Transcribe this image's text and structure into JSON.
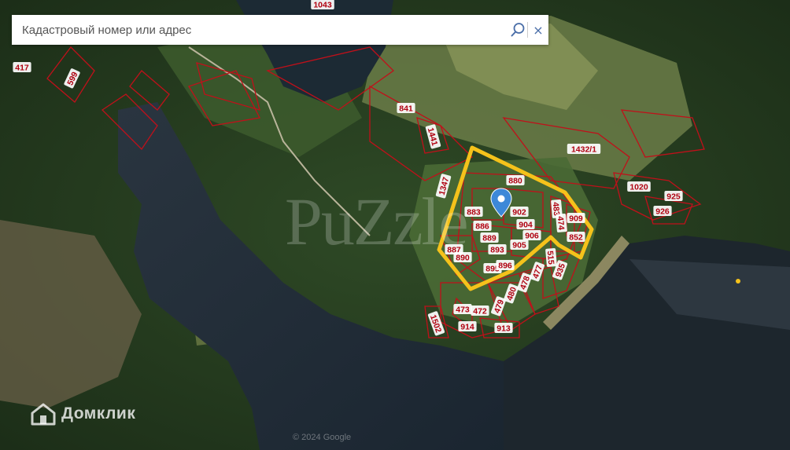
{
  "search": {
    "placeholder": "Кадастровый номер или адрес",
    "search_icon": "search-icon",
    "clear_label": "×"
  },
  "map": {
    "watermark": "PuZzle",
    "brand": "Домклик",
    "copyright": "© 2024 Google",
    "highlight_color": "#f5c21b",
    "parcel_border_color": "#c0101a",
    "marker_color": "#3d88d8",
    "parcel_labels": [
      "1043",
      "417",
      "599",
      "841",
      "1441",
      "1432/1",
      "1347",
      "880",
      "883",
      "886",
      "889",
      "887",
      "890",
      "893",
      "895",
      "896",
      "905",
      "906",
      "902",
      "904",
      "483",
      "474",
      "909",
      "852",
      "515",
      "1020",
      "925",
      "926",
      "935",
      "477",
      "478",
      "480",
      "479",
      "473",
      "472",
      "914",
      "913",
      "1502"
    ]
  }
}
